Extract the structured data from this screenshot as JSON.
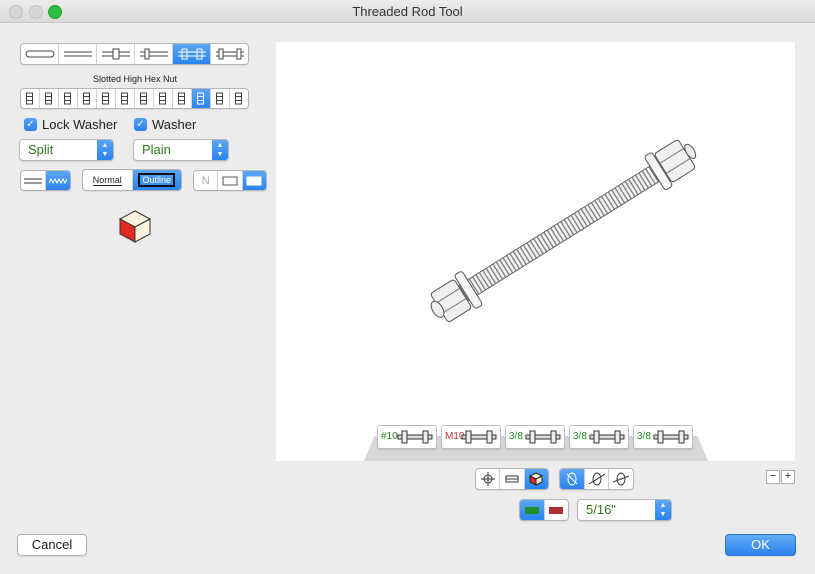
{
  "window": {
    "title": "Threaded Rod Tool"
  },
  "style_row": {
    "items": [
      "rod-plain",
      "rod-double-line",
      "rod-nut-both",
      "rod-one-end",
      "rod-hex-nuts",
      "rod-flange"
    ],
    "selected_index": 4
  },
  "nut_row": {
    "label": "Slotted High Hex Nut",
    "count": 12,
    "selected_index": 9
  },
  "options": {
    "lock_washer": {
      "label": "Lock Washer",
      "checked": true
    },
    "washer": {
      "label": "Washer",
      "checked": true
    },
    "lock_washer_type": "Split",
    "washer_type": "Plain"
  },
  "thread_style": {
    "items": [
      "double-line-icon",
      "zigzag-thread-icon"
    ],
    "selected_index": 1
  },
  "line_style": {
    "normal": "Normal",
    "outline": "Outline",
    "selected_index": 1
  },
  "view_toggle": {
    "n_label": "N",
    "selected_index": 2
  },
  "thumbnails": [
    {
      "label": "#10",
      "color": "#1e8a1e"
    },
    {
      "label": "M10",
      "color": "#c23a3a"
    },
    {
      "label": "3/8",
      "color": "#1e8a1e"
    },
    {
      "label": "3/8",
      "color": "#1e8a1e"
    },
    {
      "label": "3/8",
      "color": "#1e8a1e"
    }
  ],
  "zoom": {
    "minus": "−",
    "plus": "+"
  },
  "view_controls": {
    "left": [
      "crosshair-icon",
      "dimension-icon",
      "cube-icon"
    ],
    "right": [
      "iso-cylinder-icon",
      "tilt-left-icon",
      "tilt-right-icon"
    ],
    "left_selected": 2,
    "right_selected": 0
  },
  "size": {
    "value": "5/16\""
  },
  "buttons": {
    "cancel": "Cancel",
    "ok": "OK"
  },
  "colors": {
    "accent": "#2a84ee",
    "green_swatch": "#1f8f2e",
    "red_swatch": "#b0302f"
  }
}
